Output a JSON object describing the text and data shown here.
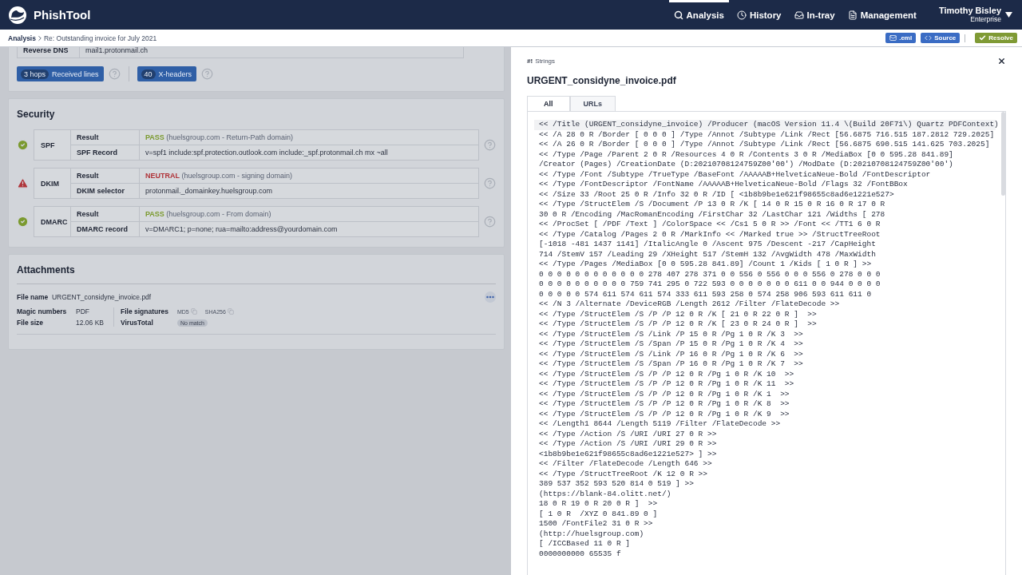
{
  "app": {
    "name": "PhishTool"
  },
  "nav": [
    {
      "label": "Analysis",
      "kind": "search",
      "selected": true
    },
    {
      "label": "History",
      "kind": "clock",
      "selected": false
    },
    {
      "label": "In-tray",
      "kind": "tray",
      "selected": false
    },
    {
      "label": "Management",
      "kind": "doc",
      "selected": false
    }
  ],
  "user": {
    "name": "Timothy Bisley",
    "plan": "Enterprise"
  },
  "breadcrumb": [
    "Analysis",
    "Re: Outstanding invoice for July 2021"
  ],
  "actions": [
    {
      "label": ".eml",
      "kind": "eml"
    },
    {
      "label": "Source",
      "kind": "source"
    },
    {
      "label": "Resolve",
      "kind": "resolve"
    }
  ],
  "headers_card": {
    "rows": [
      {
        "label": "Reverse DNS",
        "value": "mail1.protonmail.ch"
      }
    ],
    "counters": [
      {
        "count": "3 hops",
        "label": "Received lines"
      },
      {
        "count": "40",
        "label": "X-headers"
      }
    ]
  },
  "security": {
    "title": "Security",
    "checks": [
      {
        "name": "SPF",
        "kind": "pass",
        "rows": [
          {
            "label": "Result",
            "verdict": "PASS",
            "value": "(huelsgroup.com - Return-Path domain)"
          },
          {
            "label": "SPF Record",
            "value": "v=spf1 include:spf.protection.outlook.com include:_spf.protonmail.ch mx ~all"
          }
        ]
      },
      {
        "name": "DKIM",
        "kind": "neutral",
        "rows": [
          {
            "label": "Result",
            "verdict": "NEUTRAL",
            "value": "(huelsgroup.com - signing domain)"
          },
          {
            "label": "DKIM selector",
            "value": "protonmail._domainkey.huelsgroup.com"
          }
        ]
      },
      {
        "name": "DMARC",
        "kind": "pass",
        "rows": [
          {
            "label": "Result",
            "verdict": "PASS",
            "value": "(huelsgroup.com - From domain)"
          },
          {
            "label": "DMARC record",
            "value": "v=DMARC1; p=none; rua=mailto:address@yourdomain.com"
          }
        ]
      }
    ]
  },
  "attachments": {
    "title": "Attachments",
    "file_name_label": "File name",
    "file_name": "URGENT_considyne_invoice.pdf",
    "magic_label": "Magic numbers",
    "magic": "PDF",
    "size_label": "File size",
    "size": "12.06 KB",
    "signatures_label": "File signatures",
    "signatures": [
      "MD5",
      "SHA256"
    ],
    "virustotal_label": "VirusTotal",
    "virustotal": "No match"
  },
  "drawer": {
    "badge": "#!",
    "kicker": "Strings",
    "title": "URGENT_considyne_invoice.pdf",
    "tabs": [
      {
        "label": "All",
        "selected": true
      },
      {
        "label": "URLs",
        "selected": false
      }
    ],
    "lines": [
      "<< /Title (URGENT_considyne_invoice) /Producer (macOS Version 11.4 \\(Build 20F71\\) Quartz PDFContext)",
      "<< /A 28 0 R /Border [ 0 0 0 ] /Type /Annot /Subtype /Link /Rect [56.6875 716.515 187.2812 729.2025]",
      "<< /A 26 0 R /Border [ 0 0 0 ] /Type /Annot /Subtype /Link /Rect [56.6875 690.515 141.625 703.2025]",
      "<< /Type /Page /Parent 2 0 R /Resources 4 0 R /Contents 3 0 R /MediaBox [0 0 595.28 841.89]",
      "/Creator (Pages) /CreationDate (D:20210708124759Z00'00') /ModDate (D:20210708124759Z00'00')",
      "<< /Type /Font /Subtype /TrueType /BaseFont /AAAAAB+HelveticaNeue-Bold /FontDescriptor",
      "<< /Type /FontDescriptor /FontName /AAAAAB+HelveticaNeue-Bold /Flags 32 /FontBBox",
      "<< /Size 33 /Root 25 0 R /Info 32 0 R /ID [ <1b8b9be1e621f98655c8ad6e1221e527>",
      "<< /Type /StructElem /S /Document /P 13 0 R /K [ 14 0 R 15 0 R 16 0 R 17 0 R",
      "30 0 R /Encoding /MacRomanEncoding /FirstChar 32 /LastChar 121 /Widths [ 278",
      "<< /ProcSet [ /PDF /Text ] /ColorSpace << /Cs1 5 0 R >> /Font << /TT1 6 0 R",
      "<< /Type /Catalog /Pages 2 0 R /MarkInfo << /Marked true >> /StructTreeRoot",
      "[-1018 -481 1437 1141] /ItalicAngle 0 /Ascent 975 /Descent -217 /CapHeight",
      "714 /StemV 157 /Leading 29 /XHeight 517 /StemH 132 /AvgWidth 478 /MaxWidth",
      "<< /Type /Pages /MediaBox [0 0 595.28 841.89] /Count 1 /Kids [ 1 0 R ] >>",
      "0 0 0 0 0 0 0 0 0 0 0 0 278 407 278 371 0 0 556 0 556 0 0 0 556 0 278 0 0 0",
      "0 0 0 0 0 0 0 0 0 0 759 741 295 0 722 593 0 0 0 0 0 0 0 611 0 0 944 0 0 0 0",
      "0 0 0 0 0 574 611 574 611 574 333 611 593 258 0 574 258 906 593 611 611 0",
      "<< /N 3 /Alternate /DeviceRGB /Length 2612 /Filter /FlateDecode >>",
      "<< /Type /StructElem /S /P /P 12 0 R /K [ 21 0 R 22 0 R ]  >>",
      "<< /Type /StructElem /S /P /P 12 0 R /K [ 23 0 R 24 0 R ]  >>",
      "<< /Type /StructElem /S /Link /P 15 0 R /Pg 1 0 R /K 3  >>",
      "<< /Type /StructElem /S /Span /P 15 0 R /Pg 1 0 R /K 4  >>",
      "<< /Type /StructElem /S /Link /P 16 0 R /Pg 1 0 R /K 6  >>",
      "<< /Type /StructElem /S /Span /P 16 0 R /Pg 1 0 R /K 7  >>",
      "<< /Type /StructElem /S /P /P 12 0 R /Pg 1 0 R /K 10  >>",
      "<< /Type /StructElem /S /P /P 12 0 R /Pg 1 0 R /K 11  >>",
      "<< /Type /StructElem /S /P /P 12 0 R /Pg 1 0 R /K 1  >>",
      "<< /Type /StructElem /S /P /P 12 0 R /Pg 1 0 R /K 8  >>",
      "<< /Type /StructElem /S /P /P 12 0 R /Pg 1 0 R /K 9  >>",
      "<< /Length1 8644 /Length 5119 /Filter /FlateDecode >>",
      "<< /Type /Action /S /URI /URI 27 0 R >>",
      "<< /Type /Action /S /URI /URI 29 0 R >>",
      "<1b8b9be1e621f98655c8ad6e1221e527> ] >>",
      "<< /Filter /FlateDecode /Length 646 >>",
      "<< /Type /StructTreeRoot /K 12 0 R >>",
      "389 537 352 593 520 814 0 519 ] >>",
      "(https://blank-84.olitt.net/)",
      "18 0 R 19 0 R 20 0 R ]  >>",
      "[ 1 0 R  /XYZ 0 841.89 0 ]",
      "1500 /FontFile2 31 0 R >>",
      "(http://huelsgroup.com)",
      "[ /ICCBased 11 0 R ]",
      "0000000000 65535 f"
    ]
  }
}
